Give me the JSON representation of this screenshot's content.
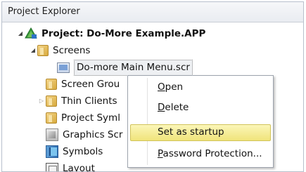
{
  "panel": {
    "title": "Project Explorer"
  },
  "tree": {
    "project": "Project: Do-More Example.APP",
    "screens": "Screens",
    "main_menu": "Do-more Main Menu.scr",
    "screen_groups": "Screen Grou",
    "thin_clients": "Thin Clients",
    "project_symbols": "Project Syml",
    "graphics_screens": "Graphics Scr",
    "symbols": "Symbols",
    "layout": "Layout"
  },
  "context_menu": {
    "open": {
      "mnemonic": "O",
      "rest": "pen"
    },
    "delete": {
      "mnemonic": "D",
      "rest": "elete"
    },
    "set_startup": "Set as startup",
    "password": {
      "mnemonic": "P",
      "rest": "assword Protection..."
    }
  }
}
